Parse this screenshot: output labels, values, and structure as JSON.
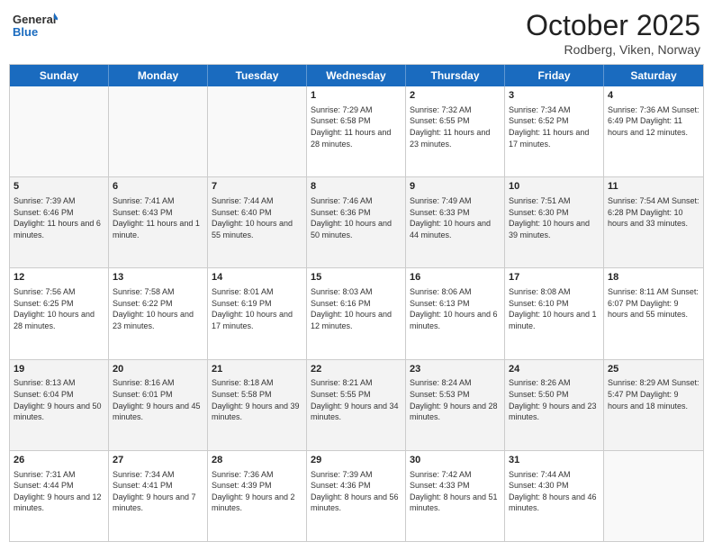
{
  "header": {
    "logo_general": "General",
    "logo_blue": "Blue",
    "month_title": "October 2025",
    "location": "Rodberg, Viken, Norway"
  },
  "weekdays": [
    "Sunday",
    "Monday",
    "Tuesday",
    "Wednesday",
    "Thursday",
    "Friday",
    "Saturday"
  ],
  "rows": [
    [
      {
        "day": "",
        "text": ""
      },
      {
        "day": "",
        "text": ""
      },
      {
        "day": "",
        "text": ""
      },
      {
        "day": "1",
        "text": "Sunrise: 7:29 AM\nSunset: 6:58 PM\nDaylight: 11 hours\nand 28 minutes."
      },
      {
        "day": "2",
        "text": "Sunrise: 7:32 AM\nSunset: 6:55 PM\nDaylight: 11 hours\nand 23 minutes."
      },
      {
        "day": "3",
        "text": "Sunrise: 7:34 AM\nSunset: 6:52 PM\nDaylight: 11 hours\nand 17 minutes."
      },
      {
        "day": "4",
        "text": "Sunrise: 7:36 AM\nSunset: 6:49 PM\nDaylight: 11 hours\nand 12 minutes."
      }
    ],
    [
      {
        "day": "5",
        "text": "Sunrise: 7:39 AM\nSunset: 6:46 PM\nDaylight: 11 hours\nand 6 minutes."
      },
      {
        "day": "6",
        "text": "Sunrise: 7:41 AM\nSunset: 6:43 PM\nDaylight: 11 hours\nand 1 minute."
      },
      {
        "day": "7",
        "text": "Sunrise: 7:44 AM\nSunset: 6:40 PM\nDaylight: 10 hours\nand 55 minutes."
      },
      {
        "day": "8",
        "text": "Sunrise: 7:46 AM\nSunset: 6:36 PM\nDaylight: 10 hours\nand 50 minutes."
      },
      {
        "day": "9",
        "text": "Sunrise: 7:49 AM\nSunset: 6:33 PM\nDaylight: 10 hours\nand 44 minutes."
      },
      {
        "day": "10",
        "text": "Sunrise: 7:51 AM\nSunset: 6:30 PM\nDaylight: 10 hours\nand 39 minutes."
      },
      {
        "day": "11",
        "text": "Sunrise: 7:54 AM\nSunset: 6:28 PM\nDaylight: 10 hours\nand 33 minutes."
      }
    ],
    [
      {
        "day": "12",
        "text": "Sunrise: 7:56 AM\nSunset: 6:25 PM\nDaylight: 10 hours\nand 28 minutes."
      },
      {
        "day": "13",
        "text": "Sunrise: 7:58 AM\nSunset: 6:22 PM\nDaylight: 10 hours\nand 23 minutes."
      },
      {
        "day": "14",
        "text": "Sunrise: 8:01 AM\nSunset: 6:19 PM\nDaylight: 10 hours\nand 17 minutes."
      },
      {
        "day": "15",
        "text": "Sunrise: 8:03 AM\nSunset: 6:16 PM\nDaylight: 10 hours\nand 12 minutes."
      },
      {
        "day": "16",
        "text": "Sunrise: 8:06 AM\nSunset: 6:13 PM\nDaylight: 10 hours\nand 6 minutes."
      },
      {
        "day": "17",
        "text": "Sunrise: 8:08 AM\nSunset: 6:10 PM\nDaylight: 10 hours\nand 1 minute."
      },
      {
        "day": "18",
        "text": "Sunrise: 8:11 AM\nSunset: 6:07 PM\nDaylight: 9 hours\nand 55 minutes."
      }
    ],
    [
      {
        "day": "19",
        "text": "Sunrise: 8:13 AM\nSunset: 6:04 PM\nDaylight: 9 hours\nand 50 minutes."
      },
      {
        "day": "20",
        "text": "Sunrise: 8:16 AM\nSunset: 6:01 PM\nDaylight: 9 hours\nand 45 minutes."
      },
      {
        "day": "21",
        "text": "Sunrise: 8:18 AM\nSunset: 5:58 PM\nDaylight: 9 hours\nand 39 minutes."
      },
      {
        "day": "22",
        "text": "Sunrise: 8:21 AM\nSunset: 5:55 PM\nDaylight: 9 hours\nand 34 minutes."
      },
      {
        "day": "23",
        "text": "Sunrise: 8:24 AM\nSunset: 5:53 PM\nDaylight: 9 hours\nand 28 minutes."
      },
      {
        "day": "24",
        "text": "Sunrise: 8:26 AM\nSunset: 5:50 PM\nDaylight: 9 hours\nand 23 minutes."
      },
      {
        "day": "25",
        "text": "Sunrise: 8:29 AM\nSunset: 5:47 PM\nDaylight: 9 hours\nand 18 minutes."
      }
    ],
    [
      {
        "day": "26",
        "text": "Sunrise: 7:31 AM\nSunset: 4:44 PM\nDaylight: 9 hours\nand 12 minutes."
      },
      {
        "day": "27",
        "text": "Sunrise: 7:34 AM\nSunset: 4:41 PM\nDaylight: 9 hours\nand 7 minutes."
      },
      {
        "day": "28",
        "text": "Sunrise: 7:36 AM\nSunset: 4:39 PM\nDaylight: 9 hours\nand 2 minutes."
      },
      {
        "day": "29",
        "text": "Sunrise: 7:39 AM\nSunset: 4:36 PM\nDaylight: 8 hours\nand 56 minutes."
      },
      {
        "day": "30",
        "text": "Sunrise: 7:42 AM\nSunset: 4:33 PM\nDaylight: 8 hours\nand 51 minutes."
      },
      {
        "day": "31",
        "text": "Sunrise: 7:44 AM\nSunset: 4:30 PM\nDaylight: 8 hours\nand 46 minutes."
      },
      {
        "day": "",
        "text": ""
      }
    ]
  ]
}
